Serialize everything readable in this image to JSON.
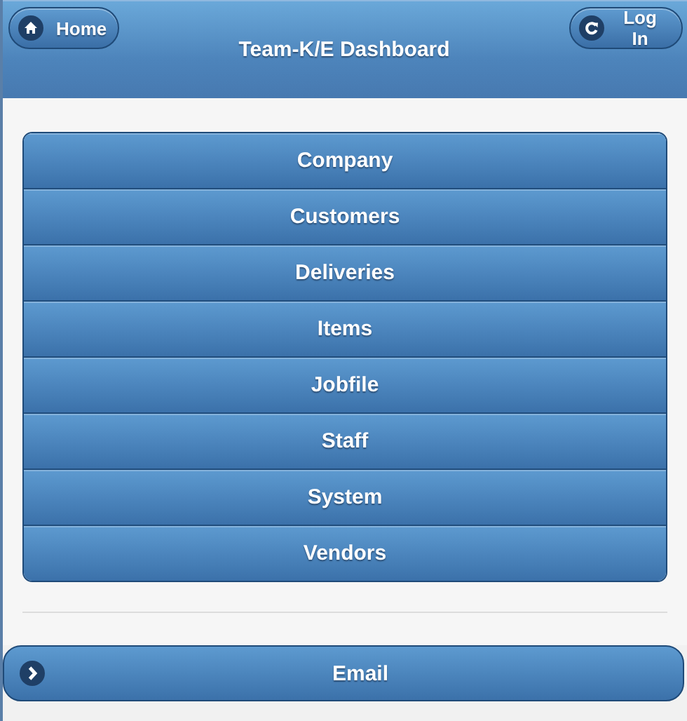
{
  "header": {
    "title": "Team-K/E Dashboard",
    "left_button": {
      "label": "Home"
    },
    "right_button": {
      "label": "Log In"
    }
  },
  "menu": [
    {
      "label": "Company"
    },
    {
      "label": "Customers"
    },
    {
      "label": "Deliveries"
    },
    {
      "label": "Items"
    },
    {
      "label": "Jobfile"
    },
    {
      "label": "Staff"
    },
    {
      "label": "System"
    },
    {
      "label": "Vendors"
    }
  ],
  "email_button": {
    "label": "Email"
  }
}
